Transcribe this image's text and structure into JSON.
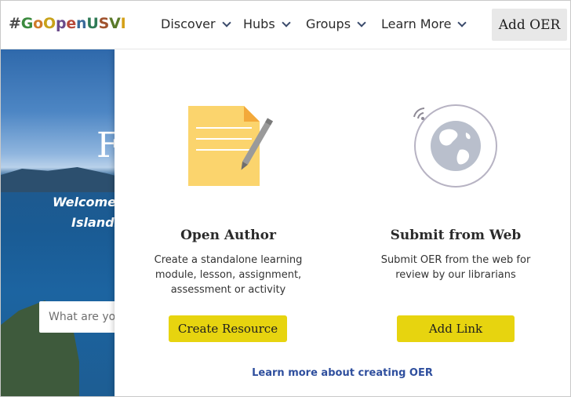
{
  "header": {
    "logo": {
      "text": "#GoOpenUSVI",
      "letters": [
        {
          "ch": "#",
          "color": "#4a4a4a"
        },
        {
          "ch": "G",
          "color": "#3b8a3e"
        },
        {
          "ch": "o",
          "color": "#d07a2a"
        },
        {
          "ch": "O",
          "color": "#c8a21a"
        },
        {
          "ch": "p",
          "color": "#6b4a8a"
        },
        {
          "ch": "e",
          "color": "#b84a3a"
        },
        {
          "ch": "n",
          "color": "#3a6a9a"
        },
        {
          "ch": "U",
          "color": "#2e7a55"
        },
        {
          "ch": "S",
          "color": "#a0522d"
        },
        {
          "ch": "V",
          "color": "#5a7a2a"
        },
        {
          "ch": "I",
          "color": "#d4a017"
        }
      ]
    },
    "nav": [
      {
        "label": "Discover"
      },
      {
        "label": "Hubs"
      },
      {
        "label": "Groups"
      },
      {
        "label": "Learn More"
      }
    ],
    "add_oer_label": "Add OER"
  },
  "hero": {
    "title_fragment": "F",
    "welcome_fragment": "Welcome t",
    "islands_fragment": "Islands",
    "search_placeholder": "What are you"
  },
  "panel": {
    "open_author": {
      "title": "Open Author",
      "description": "Create a standalone learning module, lesson, assignment, assessment or activity",
      "button_label": "Create Resource",
      "icon": "document-pencil-icon"
    },
    "submit_web": {
      "title": "Submit from Web",
      "description": "Submit OER from the web for review by our librarians",
      "button_label": "Add Link",
      "icon": "globe-wifi-icon"
    },
    "learn_more_link": "Learn more about creating OER"
  },
  "colors": {
    "button_yellow": "#e7d40f",
    "link_blue": "#2f4f9e",
    "doc_yellow": "#fbd46d",
    "globe_gray": "#b9bfcc"
  }
}
